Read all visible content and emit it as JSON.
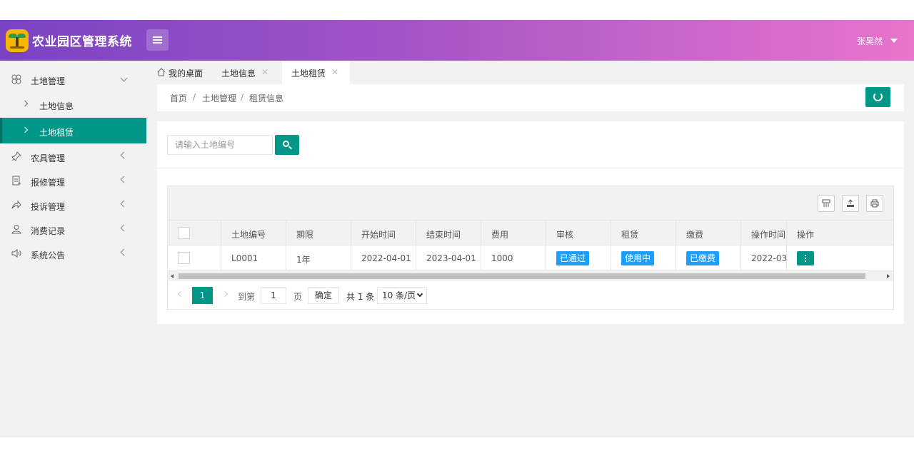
{
  "header": {
    "app_title": "农业园区管理系统",
    "user_name": "张昊然"
  },
  "sidebar": {
    "groups": [
      {
        "label": "土地管理",
        "icon": "clover-icon",
        "expanded": true
      },
      {
        "label": "农具管理",
        "icon": "pin-icon"
      },
      {
        "label": "报修管理",
        "icon": "form-icon"
      },
      {
        "label": "投诉管理",
        "icon": "share-icon"
      },
      {
        "label": "消费记录",
        "icon": "user-icon"
      },
      {
        "label": "系统公告",
        "icon": "speaker-icon"
      }
    ],
    "sub_items": [
      {
        "label": "土地信息",
        "active": false
      },
      {
        "label": "土地租赁",
        "active": true
      }
    ]
  },
  "tabs": [
    {
      "label": "我的桌面",
      "icon": "home-icon",
      "closable": false
    },
    {
      "label": "土地信息",
      "closable": true,
      "close": "✕"
    },
    {
      "label": "土地租赁",
      "closable": true,
      "close": "✕",
      "active": true
    }
  ],
  "breadcrumb": [
    "首页",
    "/",
    "土地管理",
    "/",
    "租赁信息"
  ],
  "search": {
    "placeholder": "请输入土地编号",
    "value": ""
  },
  "table": {
    "columns": [
      "",
      "土地编号",
      "期限",
      "开始时间",
      "结束时间",
      "费用",
      "审核",
      "租赁",
      "缴费",
      "操作时间",
      "操作"
    ],
    "rows": [
      {
        "land_no": "L0001",
        "term": "1年",
        "start": "2022-04-01",
        "end": "2023-04-01",
        "fee": "1000",
        "audit": "已通过",
        "lease": "使用中",
        "payment": "已缴费",
        "op_time": "2022-03-..."
      }
    ]
  },
  "pager": {
    "current": "1",
    "goto_label": "到第",
    "goto_value": "1",
    "page_unit": "页",
    "confirm": "确定",
    "total": "共 1 条",
    "page_size": "10 条/页"
  },
  "colors": {
    "accent": "#009688",
    "badge": "#1e9fff",
    "header_start": "#7a43c4",
    "header_end": "#e874cc"
  }
}
